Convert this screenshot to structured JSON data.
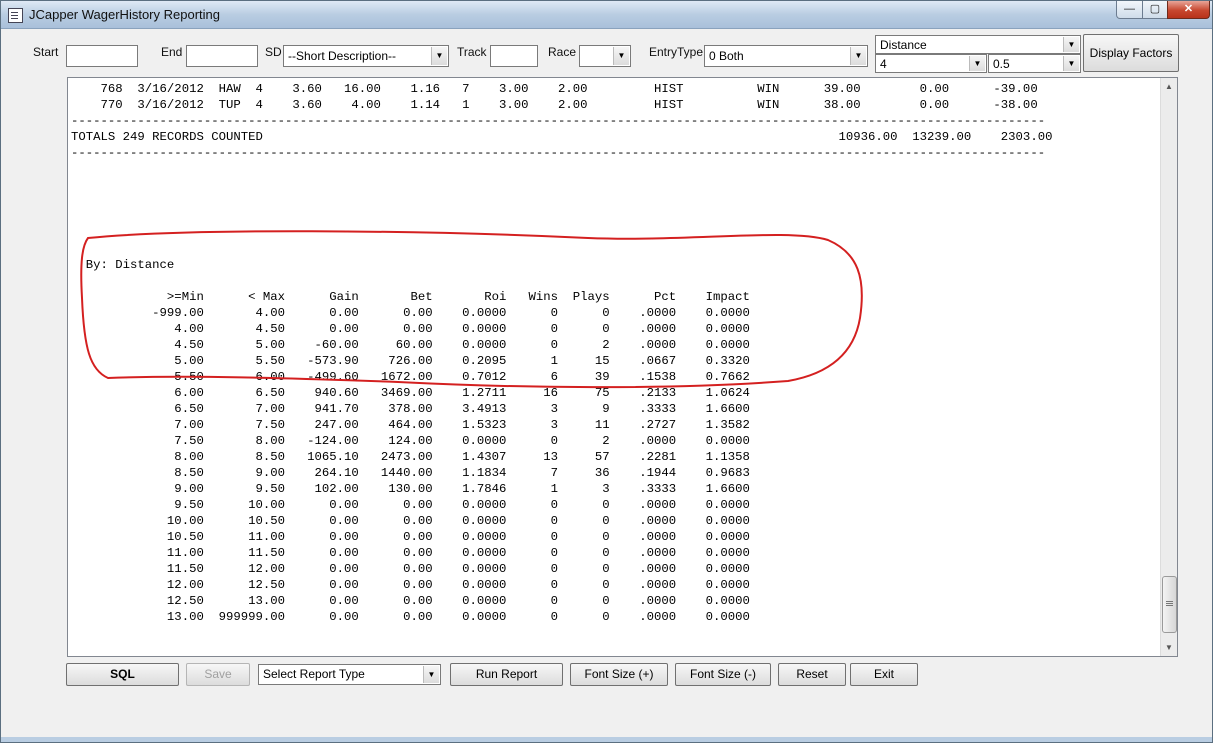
{
  "window": {
    "title": "JCapper WagerHistory Reporting",
    "buttons": {
      "minimize": "—",
      "maximize": "▢",
      "close": "✕"
    }
  },
  "toolbar": {
    "start_label": "Start",
    "start_value": "",
    "end_label": "End",
    "end_value": "",
    "sd_label": "SD",
    "sd_value": "--Short Description--",
    "track_label": "Track",
    "track_value": "",
    "race_label": "Race",
    "race_value": "",
    "entrytype_label": "EntryType",
    "entrytype_value": "0 Both",
    "factor_value": "Distance",
    "min_value": "4",
    "step_value": "0.5",
    "display_factors_label": "Display Factors"
  },
  "report": {
    "header_lines": [
      "    768  3/16/2012  HAW  4    3.60   16.00    1.16   7    3.00    2.00         HIST          WIN      39.00        0.00      -39.00",
      "    770  3/16/2012  TUP  4    3.60    4.00    1.14   1    3.00    2.00         HIST          WIN      38.00        0.00      -38.00",
      "------------------------------------------------------------------------------------------------------------------------------------",
      "TOTALS 249 RECORDS COUNTED                                                                              10936.00  13239.00    2303.00",
      "------------------------------------------------------------------------------------------------------------------------------------"
    ],
    "section_title": "By: Distance",
    "columns": [
      ">=Min",
      "< Max",
      "Gain",
      "Bet",
      "Roi",
      "Wins",
      "Plays",
      "Pct",
      "Impact"
    ],
    "rows": [
      [
        "-999.00",
        "4.00",
        "0.00",
        "0.00",
        "0.0000",
        "0",
        "0",
        ".0000",
        "0.0000"
      ],
      [
        "4.00",
        "4.50",
        "0.00",
        "0.00",
        "0.0000",
        "0",
        "0",
        ".0000",
        "0.0000"
      ],
      [
        "4.50",
        "5.00",
        "-60.00",
        "60.00",
        "0.0000",
        "0",
        "2",
        ".0000",
        "0.0000"
      ],
      [
        "5.00",
        "5.50",
        "-573.90",
        "726.00",
        "0.2095",
        "1",
        "15",
        ".0667",
        "0.3320"
      ],
      [
        "5.50",
        "6.00",
        "-499.60",
        "1672.00",
        "0.7012",
        "6",
        "39",
        ".1538",
        "0.7662"
      ],
      [
        "6.00",
        "6.50",
        "940.60",
        "3469.00",
        "1.2711",
        "16",
        "75",
        ".2133",
        "1.0624"
      ],
      [
        "6.50",
        "7.00",
        "941.70",
        "378.00",
        "3.4913",
        "3",
        "9",
        ".3333",
        "1.6600"
      ],
      [
        "7.00",
        "7.50",
        "247.00",
        "464.00",
        "1.5323",
        "3",
        "11",
        ".2727",
        "1.3582"
      ],
      [
        "7.50",
        "8.00",
        "-124.00",
        "124.00",
        "0.0000",
        "0",
        "2",
        ".0000",
        "0.0000"
      ],
      [
        "8.00",
        "8.50",
        "1065.10",
        "2473.00",
        "1.4307",
        "13",
        "57",
        ".2281",
        "1.1358"
      ],
      [
        "8.50",
        "9.00",
        "264.10",
        "1440.00",
        "1.1834",
        "7",
        "36",
        ".1944",
        "0.9683"
      ],
      [
        "9.00",
        "9.50",
        "102.00",
        "130.00",
        "1.7846",
        "1",
        "3",
        ".3333",
        "1.6600"
      ],
      [
        "9.50",
        "10.00",
        "0.00",
        "0.00",
        "0.0000",
        "0",
        "0",
        ".0000",
        "0.0000"
      ],
      [
        "10.00",
        "10.50",
        "0.00",
        "0.00",
        "0.0000",
        "0",
        "0",
        ".0000",
        "0.0000"
      ],
      [
        "10.50",
        "11.00",
        "0.00",
        "0.00",
        "0.0000",
        "0",
        "0",
        ".0000",
        "0.0000"
      ],
      [
        "11.00",
        "11.50",
        "0.00",
        "0.00",
        "0.0000",
        "0",
        "0",
        ".0000",
        "0.0000"
      ],
      [
        "11.50",
        "12.00",
        "0.00",
        "0.00",
        "0.0000",
        "0",
        "0",
        ".0000",
        "0.0000"
      ],
      [
        "12.00",
        "12.50",
        "0.00",
        "0.00",
        "0.0000",
        "0",
        "0",
        ".0000",
        "0.0000"
      ],
      [
        "12.50",
        "13.00",
        "0.00",
        "0.00",
        "0.0000",
        "0",
        "0",
        ".0000",
        "0.0000"
      ],
      [
        "13.00",
        "999999.00",
        "0.00",
        "0.00",
        "0.0000",
        "0",
        "0",
        ".0000",
        "0.0000"
      ]
    ]
  },
  "annotation": {
    "color": "#d42020"
  },
  "bottom": {
    "sql_label": "SQL",
    "save_label": "Save",
    "report_type_value": "Select Report Type",
    "run_report_label": "Run Report",
    "font_plus_label": "Font Size (+)",
    "font_minus_label": "Font Size (-)",
    "reset_label": "Reset",
    "exit_label": "Exit"
  }
}
